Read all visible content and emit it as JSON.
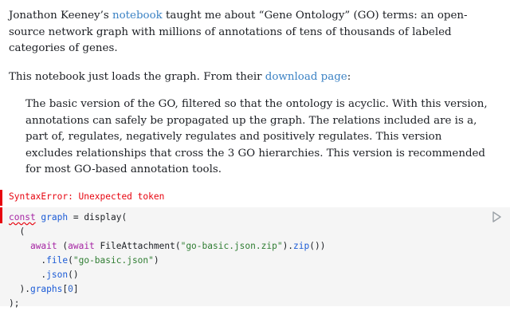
{
  "paragraph1": {
    "before_link": "Jonathon Keeney’s ",
    "link": "notebook",
    "after_link": " taught me about “Gene Ontology” (GO) terms: an open-source network graph with millions of annotations of tens of thousands of labeled categories of genes."
  },
  "paragraph2": {
    "before_link": "This notebook just loads the graph. From their ",
    "link": "download page",
    "after_link": ":"
  },
  "blockquote": "The basic version of the GO, filtered so that the ontology is acyclic. With this version, annotations can safely be propagated up the graph. The relations included are is a, part of, regulates, negatively regulates and positively regulates. This version excludes relationships that cross the 3 GO hierarchies. This version is recommended for most GO-based annotation tools.",
  "error": "SyntaxError: Unexpected token",
  "code": {
    "l1_const": "const",
    "l1_name": " graph",
    "l1_rest": " = display(",
    "l2": "  (",
    "l3_await1": "    await",
    "l3_paren": " (",
    "l3_await2": "await",
    "l3_fa": " FileAttachment(",
    "l3_str": "\"go-basic.json.zip\"",
    "l3_close": ").",
    "l3_zip": "zip",
    "l3_end": "())",
    "l4_dot": "      .",
    "l4_file": "file",
    "l4_open": "(",
    "l4_str": "\"go-basic.json\"",
    "l4_close": ")",
    "l5_dot": "      .",
    "l5_json": "json",
    "l5_end": "()",
    "l6_close": "  ).",
    "l6_graphs": "graphs",
    "l6_open": "[",
    "l6_num": "0",
    "l6_end": "]",
    "l7": ");"
  },
  "icons": {
    "run": "play-icon"
  },
  "colors": {
    "link": "#3b82c4",
    "error": "#e7040f",
    "code_background": "#f5f5f5"
  }
}
